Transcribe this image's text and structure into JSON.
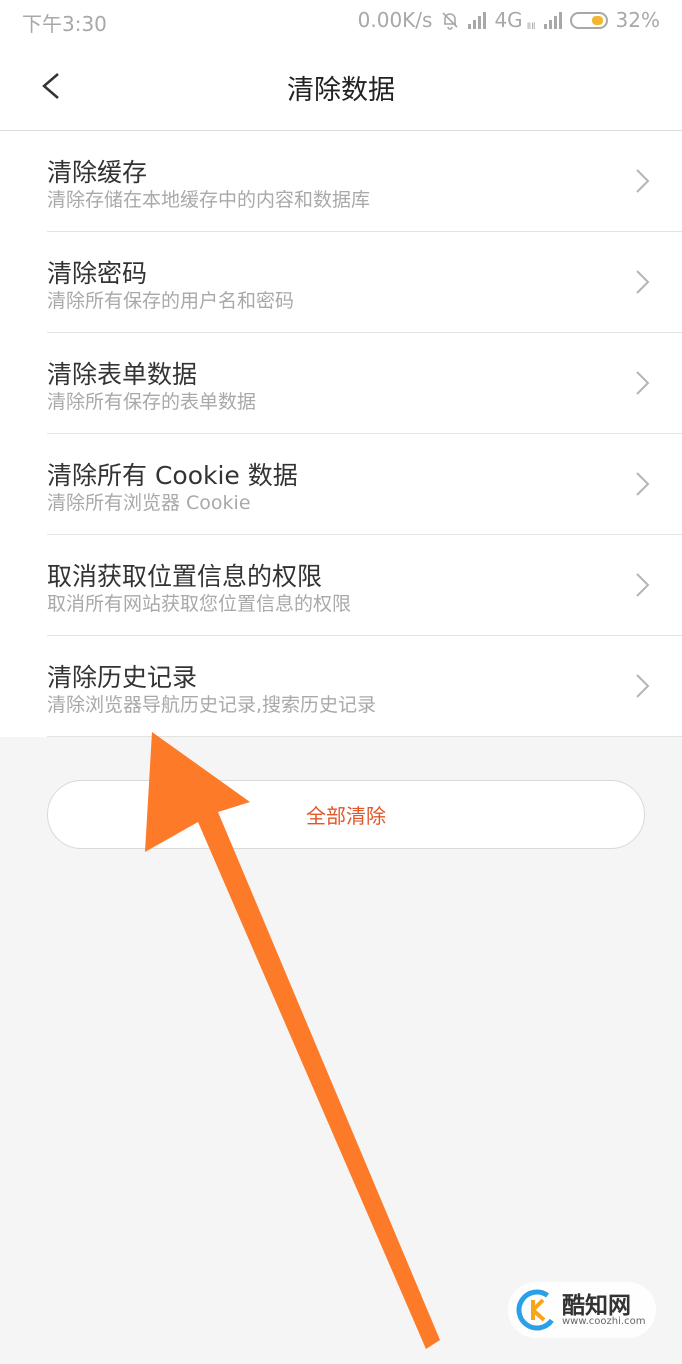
{
  "status_bar": {
    "time": "下午3:30",
    "network_speed": "0.00K/s",
    "network_type": "4G",
    "network_subscript": "ⅡⅡ",
    "battery": "32%"
  },
  "header": {
    "title": "清除数据"
  },
  "items": [
    {
      "title": "清除缓存",
      "subtitle": "清除存储在本地缓存中的内容和数据库"
    },
    {
      "title": "清除密码",
      "subtitle": "清除所有保存的用户名和密码"
    },
    {
      "title": "清除表单数据",
      "subtitle": "清除所有保存的表单数据"
    },
    {
      "title": "清除所有 Cookie 数据",
      "subtitle": "清除所有浏览器 Cookie"
    },
    {
      "title": "取消获取位置信息的权限",
      "subtitle": "取消所有网站获取您位置信息的权限"
    },
    {
      "title": "清除历史记录",
      "subtitle": "清除浏览器导航历史记录,搜索历史记录"
    }
  ],
  "clear_all_label": "全部清除",
  "watermark": {
    "name": "酷知网",
    "url": "www.coozhi.com"
  },
  "colors": {
    "accent": "#e0572a",
    "annotation_arrow": "#fc7a28",
    "battery_fill": "#f2b632"
  },
  "icons": {
    "back": "chevron-left-icon",
    "row_arrow": "chevron-right-icon",
    "mute": "bell-off-icon",
    "signal": "signal-bars-icon",
    "battery": "battery-icon"
  }
}
